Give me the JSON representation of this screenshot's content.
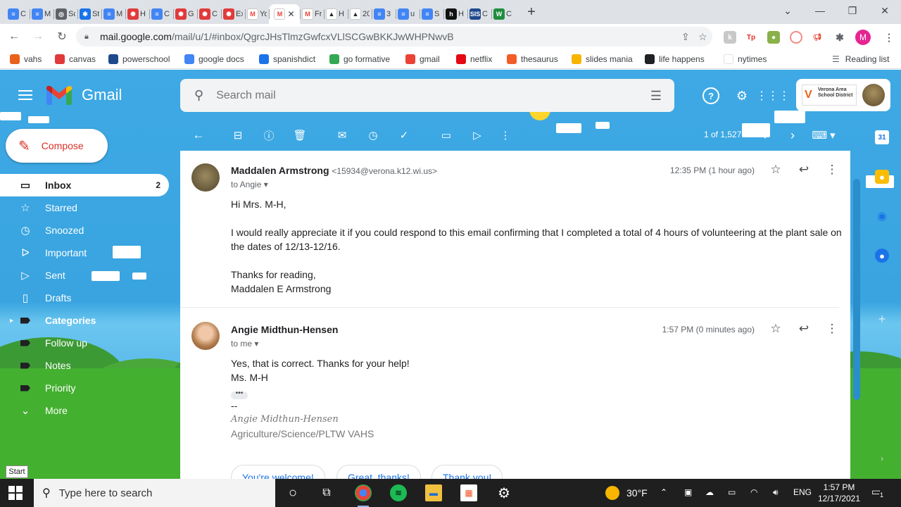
{
  "browser": {
    "tabs": [
      {
        "fav": "docs",
        "label": "C"
      },
      {
        "fav": "docs",
        "label": "M"
      },
      {
        "fav": "chat",
        "label": "Sc"
      },
      {
        "fav": "snow",
        "label": "St"
      },
      {
        "fav": "docs",
        "label": "M"
      },
      {
        "fav": "canvas",
        "label": "H"
      },
      {
        "fav": "docs",
        "label": "C"
      },
      {
        "fav": "canvas",
        "label": "G"
      },
      {
        "fav": "canvas",
        "label": "C"
      },
      {
        "fav": "canvas",
        "label": "Ex"
      },
      {
        "fav": "gmail",
        "label": "Yo"
      },
      {
        "fav": "gmail2",
        "label": "",
        "active": true
      },
      {
        "fav": "gmail",
        "label": "Fr"
      },
      {
        "fav": "drive",
        "label": "H"
      },
      {
        "fav": "drive",
        "label": "20"
      },
      {
        "fav": "docs",
        "label": "3"
      },
      {
        "fav": "docs",
        "label": "u"
      },
      {
        "fav": "docs",
        "label": "S"
      },
      {
        "fav": "h",
        "label": "H"
      },
      {
        "fav": "sis",
        "label": "C"
      },
      {
        "fav": "green",
        "label": "C"
      }
    ],
    "new_tab": "+",
    "url_host": "mail.google.com",
    "url_path": "/mail/u/1/#inbox/QgrcJHsTlmzGwfcxVLlSCGwBKKJwWHPNwvB",
    "profile_initial": "M",
    "bookmarks": [
      {
        "label": "vahs",
        "color": "#e8621a"
      },
      {
        "label": "canvas",
        "color": "#e13a3a"
      },
      {
        "label": "powerschool",
        "color": "#1e4a8c"
      },
      {
        "label": "google docs",
        "color": "#4285f4"
      },
      {
        "label": "spanishdict",
        "color": "#1a73e8"
      },
      {
        "label": "go formative",
        "color": "#34a853"
      },
      {
        "label": "gmail",
        "color": "#ea4335"
      },
      {
        "label": "netflix",
        "color": "#e50914"
      },
      {
        "label": "thesaurus",
        "color": "#f25c26"
      },
      {
        "label": "slides mania",
        "color": "#f7b500"
      },
      {
        "label": "life happens",
        "color": "#202124"
      },
      {
        "label": "nytimes",
        "color": "#ffffff"
      }
    ],
    "reading_list": "Reading list"
  },
  "gmail": {
    "brand": "Gmail",
    "search_placeholder": "Search mail",
    "district_lines": [
      "Verona Area",
      "School District"
    ],
    "compose": "Compose",
    "nav": [
      {
        "label": "Inbox",
        "icon": "inbox-icon",
        "glyph": "▭",
        "count": "2",
        "active": true
      },
      {
        "label": "Starred",
        "icon": "star-icon",
        "glyph": "☆"
      },
      {
        "label": "Snoozed",
        "icon": "clock-icon",
        "glyph": "◷"
      },
      {
        "label": "Important",
        "icon": "important-icon",
        "glyph": "ᐅ"
      },
      {
        "label": "Sent",
        "icon": "send-icon",
        "glyph": "▷"
      },
      {
        "label": "Drafts",
        "icon": "draft-icon",
        "glyph": "▯"
      },
      {
        "label": "Categories",
        "icon": "label-icon",
        "bold": true
      },
      {
        "label": "Follow up",
        "icon": "label-icon"
      },
      {
        "label": "Notes",
        "icon": "label-icon"
      },
      {
        "label": "Priority",
        "icon": "label-icon"
      },
      {
        "label": "More",
        "icon": "chevron-down-icon",
        "glyph": "⌄"
      }
    ],
    "pager": "1 of 1,527",
    "start_tooltip": "Start"
  },
  "messages": [
    {
      "sender": "Maddalen Armstrong",
      "email": "<15934@verona.k12.wi.us>",
      "to": "to Angie",
      "time": "12:35 PM (1 hour ago)",
      "greeting": "Hi Mrs. M-H,",
      "paragraph": "I would really appreciate it if you could respond to this email confirming that I completed a total of 4 hours of volunteering at the plant sale on the dates of 12/13-12/16.",
      "closing": "Thanks for reading,",
      "signoff": "Maddalen E Armstrong"
    },
    {
      "sender": "Angie Midthun-Hensen",
      "to": "to me",
      "time": "1:57 PM (0 minutes ago)",
      "line1": "Yes, that is correct.  Thanks for your help!",
      "line2": "Ms. M-H",
      "sig_dash": "--",
      "sig_name": "Angie Midthun-Hensen",
      "sig_role": "Agriculture/Science/PLTW VAHS"
    }
  ],
  "smart_replies": [
    "You're welcome!",
    "Great, thanks!",
    "Thank you!"
  ],
  "taskbar": {
    "search_placeholder": "Type here to search",
    "temperature": "30°F",
    "language": "ENG",
    "time": "1:57 PM",
    "date": "12/17/2021",
    "notifications": "1"
  }
}
